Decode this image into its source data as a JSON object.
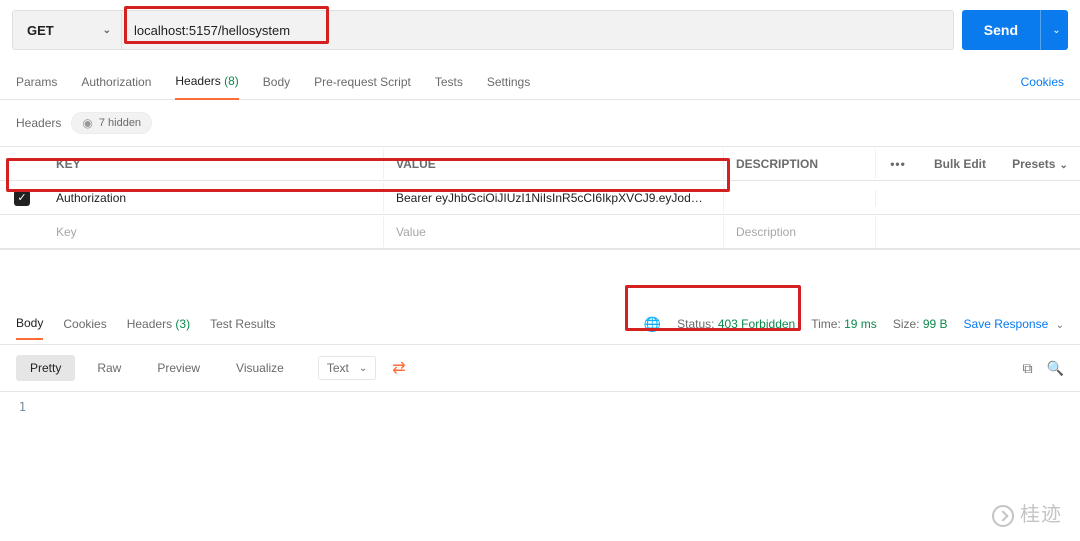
{
  "request": {
    "method": "GET",
    "url": "localhost:5157/hellosystem",
    "send_label": "Send"
  },
  "req_tabs": {
    "params": "Params",
    "authorization": "Authorization",
    "headers": "Headers",
    "headers_count": "(8)",
    "body": "Body",
    "prerequest": "Pre-request Script",
    "tests": "Tests",
    "settings": "Settings",
    "cookies": "Cookies"
  },
  "headers_section": {
    "title": "Headers",
    "hidden_text": "7 hidden"
  },
  "table": {
    "cols": {
      "key": "KEY",
      "value": "VALUE",
      "desc": "DESCRIPTION",
      "bulk": "Bulk Edit",
      "presets": "Presets"
    },
    "rows": [
      {
        "checked": true,
        "key": "Authorization",
        "value": "Bearer eyJhbGciOiJIUzI1NiIsInR5cCI6IkpXVCJ9.eyJod…",
        "desc": ""
      }
    ],
    "placeholder": {
      "key": "Key",
      "value": "Value",
      "desc": "Description"
    }
  },
  "resp_tabs": {
    "body": "Body",
    "cookies": "Cookies",
    "headers": "Headers",
    "headers_count": "(3)",
    "test_results": "Test Results"
  },
  "resp_meta": {
    "status_label": "Status:",
    "status_value": "403 Forbidden",
    "time_label": "Time:",
    "time_value": "19 ms",
    "size_label": "Size:",
    "size_value": "99 B",
    "save": "Save Response"
  },
  "view": {
    "pretty": "Pretty",
    "raw": "Raw",
    "preview": "Preview",
    "visualize": "Visualize",
    "format": "Text"
  },
  "code": {
    "line1_num": "1"
  },
  "watermark": "桂迹"
}
